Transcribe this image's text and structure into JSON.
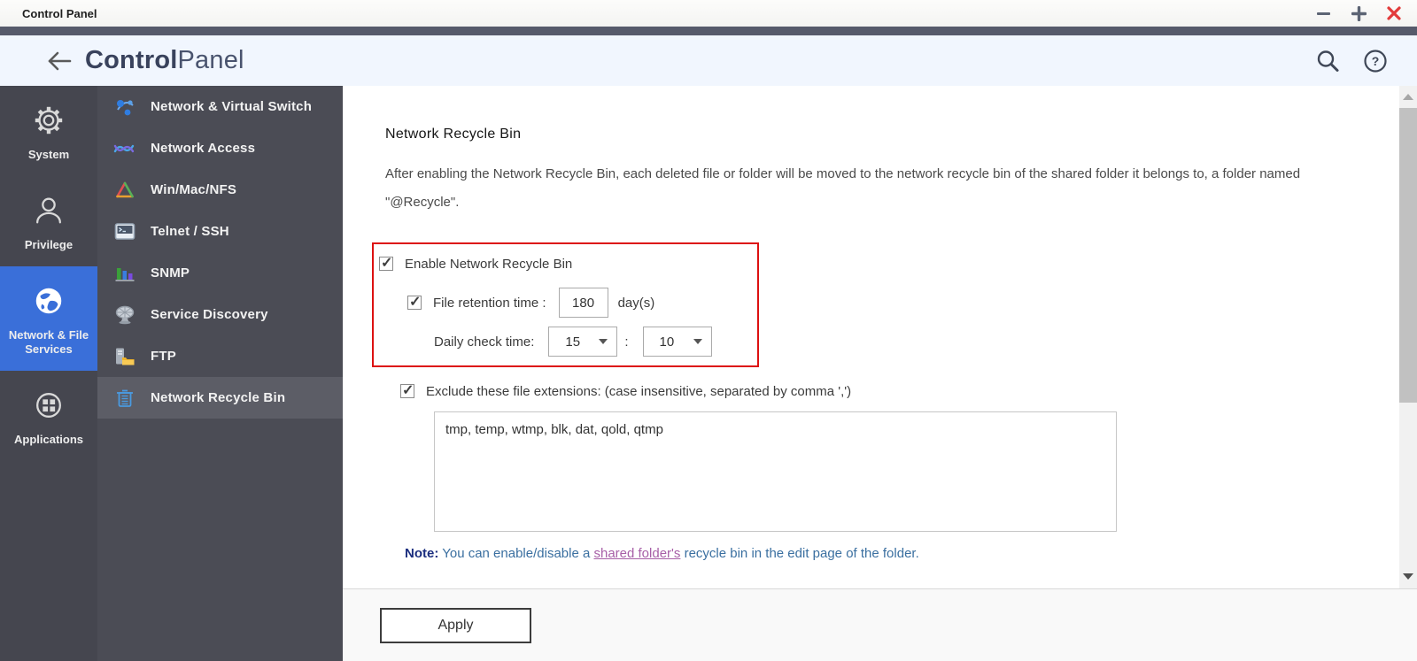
{
  "window": {
    "title": "Control Panel"
  },
  "header": {
    "title_bold": "Control",
    "title_light": "Panel"
  },
  "sidebar_primary": {
    "items": [
      {
        "label": "System",
        "icon": "gear-icon",
        "active": false
      },
      {
        "label": "Privilege",
        "icon": "user-icon",
        "active": false
      },
      {
        "label": "Network & File Services",
        "icon": "globe-icon",
        "active": true
      },
      {
        "label": "Applications",
        "icon": "apps-grid-icon",
        "active": false
      }
    ]
  },
  "sidebar_secondary": {
    "items": [
      {
        "label": "Network & Virtual Switch",
        "icon": "virtual-switch-icon",
        "active": false
      },
      {
        "label": "Network Access",
        "icon": "network-access-icon",
        "active": false
      },
      {
        "label": "Win/Mac/NFS",
        "icon": "win-mac-nfs-icon",
        "active": false
      },
      {
        "label": "Telnet / SSH",
        "icon": "terminal-icon",
        "active": false
      },
      {
        "label": "SNMP",
        "icon": "bar-chart-icon",
        "active": false
      },
      {
        "label": "Service Discovery",
        "icon": "radar-dish-icon",
        "active": false
      },
      {
        "label": "FTP",
        "icon": "ftp-server-folder-icon",
        "active": false
      },
      {
        "label": "Network Recycle Bin",
        "icon": "recycle-bin-icon",
        "active": true
      }
    ]
  },
  "content": {
    "heading": "Network Recycle Bin",
    "description": "After enabling the Network Recycle Bin, each deleted file or folder will be moved to the network recycle bin of the shared folder it belongs to, a folder named \"@Recycle\".",
    "enable_label": "Enable Network Recycle Bin",
    "retention_label": "File retention time :",
    "retention_value": "180",
    "retention_unit": "day(s)",
    "daily_check_label": "Daily check time:",
    "daily_check_hour": "15",
    "daily_check_separator": ":",
    "daily_check_minute": "10",
    "exclude_label": "Exclude these file extensions: (case insensitive, separated by comma ',')",
    "extensions_value": "tmp, temp, wtmp, blk, dat, qold, qtmp",
    "note_label": "Note:",
    "note_before_link": " You can enable/disable a ",
    "note_link": "shared folder's",
    "note_after_link": " recycle bin in the edit page of the folder.",
    "apply_label": "Apply"
  },
  "colors": {
    "accent_blue": "#3a6fd9",
    "sidebar_primary_bg": "#45464f",
    "sidebar_secondary_bg": "#4b4c55",
    "highlight_red_border": "#dd1111",
    "note_heading": "#1b2e7f",
    "note_text": "#3a6fa0",
    "note_link": "#a75fa7",
    "close_button_red": "#e23b3b"
  }
}
